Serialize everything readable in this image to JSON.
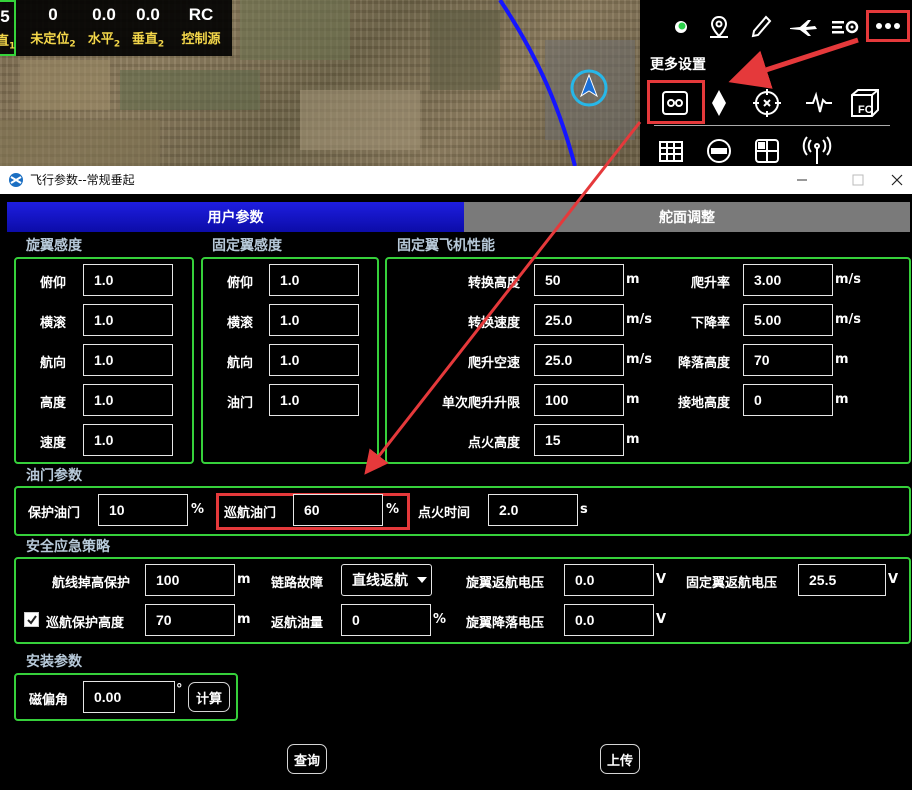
{
  "hud": {
    "cells": [
      {
        "value": "5",
        "label": "直",
        "sub": "1"
      },
      {
        "value": "0",
        "label": "未定位",
        "sub": "2"
      },
      {
        "value": "0.0",
        "label": "水平",
        "sub": "2"
      },
      {
        "value": "0.0",
        "label": "垂直",
        "sub": "2"
      },
      {
        "value": "RC",
        "label": "控制源",
        "sub": ""
      }
    ]
  },
  "panel": {
    "title": "更多设置",
    "toolbar_icons": [
      "signal-dot-icon",
      "map-pin-icon",
      "pen-icon",
      "airplane-icon",
      "settings-list-icon",
      "more-dots-icon"
    ],
    "settings_icons": [
      "gear-settings-icon",
      "diamond-icon",
      "target-icon",
      "waveform-icon",
      "fc-icon",
      "table-icon",
      "toggle-icon",
      "grid-icon",
      "antenna-icon"
    ],
    "fc_label": "FC"
  },
  "window": {
    "title": "飞行参数--常规垂起",
    "controls": [
      "minimize-icon",
      "maximize-icon",
      "close-icon"
    ]
  },
  "tabs": {
    "user": "用户参数",
    "rudder": "舵面调整"
  },
  "rotor_sensitivity": {
    "title": "旋翼感度",
    "fields": [
      {
        "label": "俯仰",
        "value": "1.0"
      },
      {
        "label": "横滚",
        "value": "1.0"
      },
      {
        "label": "航向",
        "value": "1.0"
      },
      {
        "label": "高度",
        "value": "1.0"
      },
      {
        "label": "速度",
        "value": "1.0"
      }
    ]
  },
  "fixed_sensitivity": {
    "title": "固定翼感度",
    "fields": [
      {
        "label": "俯仰",
        "value": "1.0"
      },
      {
        "label": "横滚",
        "value": "1.0"
      },
      {
        "label": "航向",
        "value": "1.0"
      },
      {
        "label": "油门",
        "value": "1.0"
      }
    ]
  },
  "performance": {
    "title": "固定翼飞机性能",
    "left": [
      {
        "label": "转换高度",
        "value": "50",
        "unit": "m"
      },
      {
        "label": "转换速度",
        "value": "25.0",
        "unit": "m/s"
      },
      {
        "label": "爬升空速",
        "value": "25.0",
        "unit": "m/s"
      },
      {
        "label": "单次爬升升限",
        "value": "100",
        "unit": "m"
      },
      {
        "label": "点火高度",
        "value": "15",
        "unit": "m"
      }
    ],
    "right": [
      {
        "label": "爬升率",
        "value": "3.00",
        "unit": "m/s"
      },
      {
        "label": "下降率",
        "value": "5.00",
        "unit": "m/s"
      },
      {
        "label": "降落高度",
        "value": "70",
        "unit": "m"
      },
      {
        "label": "接地高度",
        "value": "0",
        "unit": "m"
      }
    ]
  },
  "throttle": {
    "title": "油门参数",
    "protect": {
      "label": "保护油门",
      "value": "10",
      "unit": "%"
    },
    "cruise": {
      "label": "巡航油门",
      "value": "60",
      "unit": "%"
    },
    "ignition": {
      "label": "点火时间",
      "value": "2.0",
      "unit": "s"
    }
  },
  "safety": {
    "title": "安全应急策略",
    "route_drop": {
      "label": "航线掉高保护",
      "value": "100",
      "unit": "m"
    },
    "link_fail": {
      "label": "链路故障",
      "value": "直线返航"
    },
    "rotor_rtl_v": {
      "label": "旋翼返航电压",
      "value": "0.0",
      "unit": "V"
    },
    "fixed_rtl_v": {
      "label": "固定翼返航电压",
      "value": "25.5",
      "unit": "V"
    },
    "cruise_alt": {
      "label": "巡航保护高度",
      "value": "70",
      "unit": "m",
      "checked": true
    },
    "rtl_fuel": {
      "label": "返航油量",
      "value": "0",
      "unit": "%"
    },
    "rotor_land_v": {
      "label": "旋翼降落电压",
      "value": "0.0",
      "unit": "V"
    }
  },
  "install": {
    "title": "安装参数",
    "mag": {
      "label": "磁偏角",
      "value": "0.00",
      "unit": "°"
    },
    "calc_label": "计算"
  },
  "actions": {
    "query": "查询",
    "upload": "上传"
  },
  "colors": {
    "group_border": "#36d03b",
    "highlight": "#e5393b",
    "active_tab": "#1414c8",
    "inactive_tab": "#7a7a7a",
    "hud_label": "#f4d74a",
    "section_title": "#b7c9d9"
  }
}
